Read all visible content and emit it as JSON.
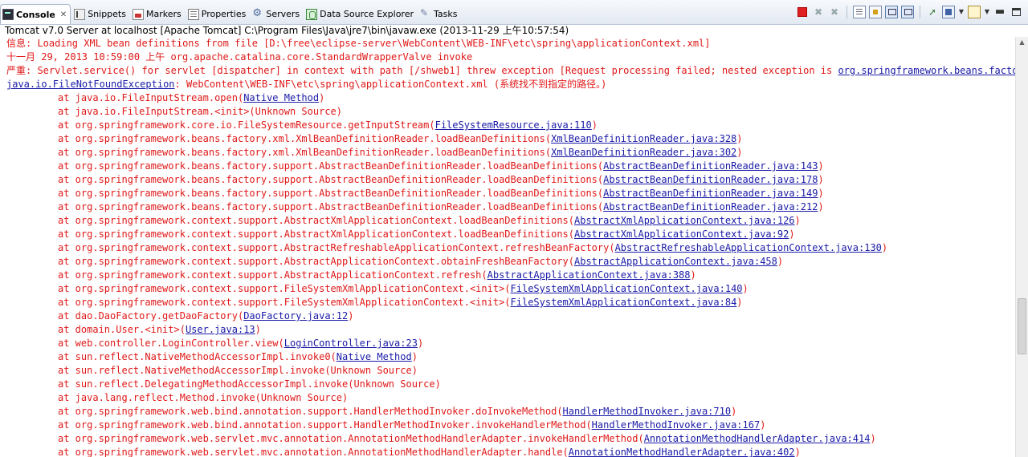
{
  "tabs": [
    {
      "label": "Console",
      "icon": "console-icon",
      "active": true
    },
    {
      "label": "Snippets",
      "icon": "snippets-icon"
    },
    {
      "label": "Markers",
      "icon": "markers-icon"
    },
    {
      "label": "Properties",
      "icon": "properties-icon"
    },
    {
      "label": "Servers",
      "icon": "servers-icon"
    },
    {
      "label": "Data Source Explorer",
      "icon": "data-source-icon"
    },
    {
      "label": "Tasks",
      "icon": "tasks-icon"
    }
  ],
  "toolbar": {
    "icons": [
      "terminate-icon",
      "remove-launch-icon",
      "remove-all-terminated-icon",
      "clear-console-icon",
      "scroll-lock-icon",
      "show-console-on-output-icon",
      "pin-console-icon",
      "display-selected-console-icon",
      "open-console-icon",
      "minimize-icon",
      "maximize-icon"
    ]
  },
  "launch_description": "Tomcat v7.0 Server at localhost [Apache Tomcat] C:\\Program Files\\Java\\jre7\\bin\\javaw.exe (2013-11-29 上午10:57:54)",
  "console": {
    "lines": [
      {
        "text": "信息: Loading XML bean definitions from file [D:\\free\\eclipse-server\\WebContent\\WEB-INF\\etc\\spring\\applicationContext.xml]"
      },
      {
        "text": "十一月 29, 2013 10:59:00 上午 org.apache.catalina.core.StandardWrapperValve invoke"
      },
      {
        "text": "严重: Servlet.service() for servlet [dispatcher] in context with path [/shweb1] threw exception [Request processing failed; nested exception is ",
        "link": "org.springframework.beans.factory.BeanDefinitionStoreException"
      },
      {
        "link_prefix": "java.io.FileNotFoundException",
        "text": ": WebContent\\WEB-INF\\etc\\spring\\applicationContext.xml (系统找不到指定的路径。)"
      },
      {
        "indent": true,
        "text": "at java.io.FileInputStream.open(",
        "link": "Native Method",
        "suffix": ")"
      },
      {
        "indent": true,
        "text": "at java.io.FileInputStream.<init>(Unknown Source)"
      },
      {
        "indent": true,
        "text": "at org.springframework.core.io.FileSystemResource.getInputStream(",
        "link": "FileSystemResource.java:110",
        "suffix": ")"
      },
      {
        "indent": true,
        "text": "at org.springframework.beans.factory.xml.XmlBeanDefinitionReader.loadBeanDefinitions(",
        "link": "XmlBeanDefinitionReader.java:328",
        "suffix": ")"
      },
      {
        "indent": true,
        "text": "at org.springframework.beans.factory.xml.XmlBeanDefinitionReader.loadBeanDefinitions(",
        "link": "XmlBeanDefinitionReader.java:302",
        "suffix": ")"
      },
      {
        "indent": true,
        "text": "at org.springframework.beans.factory.support.AbstractBeanDefinitionReader.loadBeanDefinitions(",
        "link": "AbstractBeanDefinitionReader.java:143",
        "suffix": ")"
      },
      {
        "indent": true,
        "text": "at org.springframework.beans.factory.support.AbstractBeanDefinitionReader.loadBeanDefinitions(",
        "link": "AbstractBeanDefinitionReader.java:178",
        "suffix": ")"
      },
      {
        "indent": true,
        "text": "at org.springframework.beans.factory.support.AbstractBeanDefinitionReader.loadBeanDefinitions(",
        "link": "AbstractBeanDefinitionReader.java:149",
        "suffix": ")"
      },
      {
        "indent": true,
        "text": "at org.springframework.beans.factory.support.AbstractBeanDefinitionReader.loadBeanDefinitions(",
        "link": "AbstractBeanDefinitionReader.java:212",
        "suffix": ")"
      },
      {
        "indent": true,
        "text": "at org.springframework.context.support.AbstractXmlApplicationContext.loadBeanDefinitions(",
        "link": "AbstractXmlApplicationContext.java:126",
        "suffix": ")"
      },
      {
        "indent": true,
        "text": "at org.springframework.context.support.AbstractXmlApplicationContext.loadBeanDefinitions(",
        "link": "AbstractXmlApplicationContext.java:92",
        "suffix": ")"
      },
      {
        "indent": true,
        "text": "at org.springframework.context.support.AbstractRefreshableApplicationContext.refreshBeanFactory(",
        "link": "AbstractRefreshableApplicationContext.java:130",
        "suffix": ")"
      },
      {
        "indent": true,
        "text": "at org.springframework.context.support.AbstractApplicationContext.obtainFreshBeanFactory(",
        "link": "AbstractApplicationContext.java:458",
        "suffix": ")"
      },
      {
        "indent": true,
        "text": "at org.springframework.context.support.AbstractApplicationContext.refresh(",
        "link": "AbstractApplicationContext.java:388",
        "suffix": ")"
      },
      {
        "indent": true,
        "text": "at org.springframework.context.support.FileSystemXmlApplicationContext.<init>(",
        "link": "FileSystemXmlApplicationContext.java:140",
        "suffix": ")"
      },
      {
        "indent": true,
        "text": "at org.springframework.context.support.FileSystemXmlApplicationContext.<init>(",
        "link": "FileSystemXmlApplicationContext.java:84",
        "suffix": ")"
      },
      {
        "indent": true,
        "text": "at dao.DaoFactory.getDaoFactory(",
        "link": "DaoFactory.java:12",
        "suffix": ")"
      },
      {
        "indent": true,
        "text": "at domain.User.<init>(",
        "link": "User.java:13",
        "suffix": ")"
      },
      {
        "indent": true,
        "text": "at web.controller.LoginController.view(",
        "link": "LoginController.java:23",
        "suffix": ")"
      },
      {
        "indent": true,
        "text": "at sun.reflect.NativeMethodAccessorImpl.invoke0(",
        "link": "Native Method",
        "suffix": ")"
      },
      {
        "indent": true,
        "text": "at sun.reflect.NativeMethodAccessorImpl.invoke(Unknown Source)"
      },
      {
        "indent": true,
        "text": "at sun.reflect.DelegatingMethodAccessorImpl.invoke(Unknown Source)"
      },
      {
        "indent": true,
        "text": "at java.lang.reflect.Method.invoke(Unknown Source)"
      },
      {
        "indent": true,
        "text": "at org.springframework.web.bind.annotation.support.HandlerMethodInvoker.doInvokeMethod(",
        "link": "HandlerMethodInvoker.java:710",
        "suffix": ")"
      },
      {
        "indent": true,
        "text": "at org.springframework.web.bind.annotation.support.HandlerMethodInvoker.invokeHandlerMethod(",
        "link": "HandlerMethodInvoker.java:167",
        "suffix": ")"
      },
      {
        "indent": true,
        "text": "at org.springframework.web.servlet.mvc.annotation.AnnotationMethodHandlerAdapter.invokeHandlerMethod(",
        "link": "AnnotationMethodHandlerAdapter.java:414",
        "suffix": ")"
      },
      {
        "indent": true,
        "text": "at org.springframework.web.servlet.mvc.annotation.AnnotationMethodHandlerAdapter.handle(",
        "link": "AnnotationMethodHandlerAdapter.java:402",
        "suffix": ")"
      }
    ]
  },
  "colors": {
    "error_text": "#e01818",
    "link": "#1a1aa8",
    "tab_bar": "#e3e9f2"
  }
}
